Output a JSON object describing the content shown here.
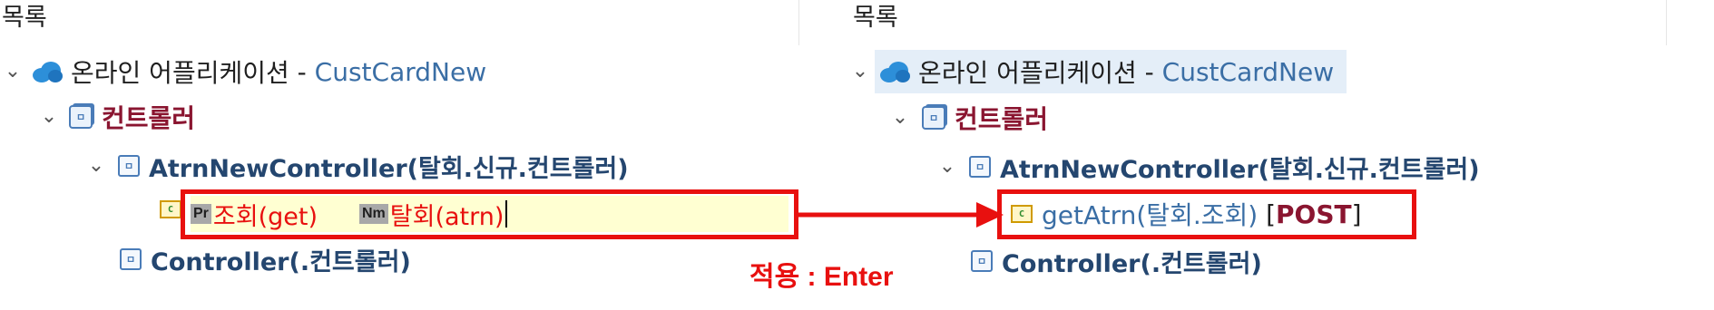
{
  "left_panel": {
    "header": "목록",
    "app_node": {
      "name": "온라인 어플리케이션",
      "sep": " - ",
      "project": "CustCardNew"
    },
    "controller_folder": "컨트롤러",
    "controller_node": "AtrnNewController(탈회.신규.컨트롤러)",
    "edit": {
      "method_icon": "C",
      "chip1": "Pr",
      "text1": "조회(get)",
      "chip2": "Nm",
      "text2": "탈회(atrn)"
    },
    "controller_node2": "Controller(.컨트롤러)"
  },
  "right_panel": {
    "header": "목록",
    "app_node": {
      "name": "온라인 어플리케이션",
      "sep": " - ",
      "project": "CustCardNew"
    },
    "controller_folder": "컨트롤러",
    "controller_node": "AtrnNewController(탈회.신규.컨트롤러)",
    "method": {
      "icon": "C",
      "name": "getAtrn(탈회.조회)",
      "open": " [",
      "http": "POST",
      "close": "]"
    },
    "controller_node2": "Controller(.컨트롤러)"
  },
  "annotation": {
    "apply_text": "적용 : Enter"
  },
  "colors": {
    "highlight_red": "#e8100f",
    "edit_bg": "#ffffd2",
    "selection_bg": "#e4eef8"
  },
  "icons": {
    "expand": "chevron-down-icon",
    "app": "cloud-icon",
    "folder": "controller-folder-icon",
    "class": "controller-class-icon",
    "method": "method-icon"
  }
}
